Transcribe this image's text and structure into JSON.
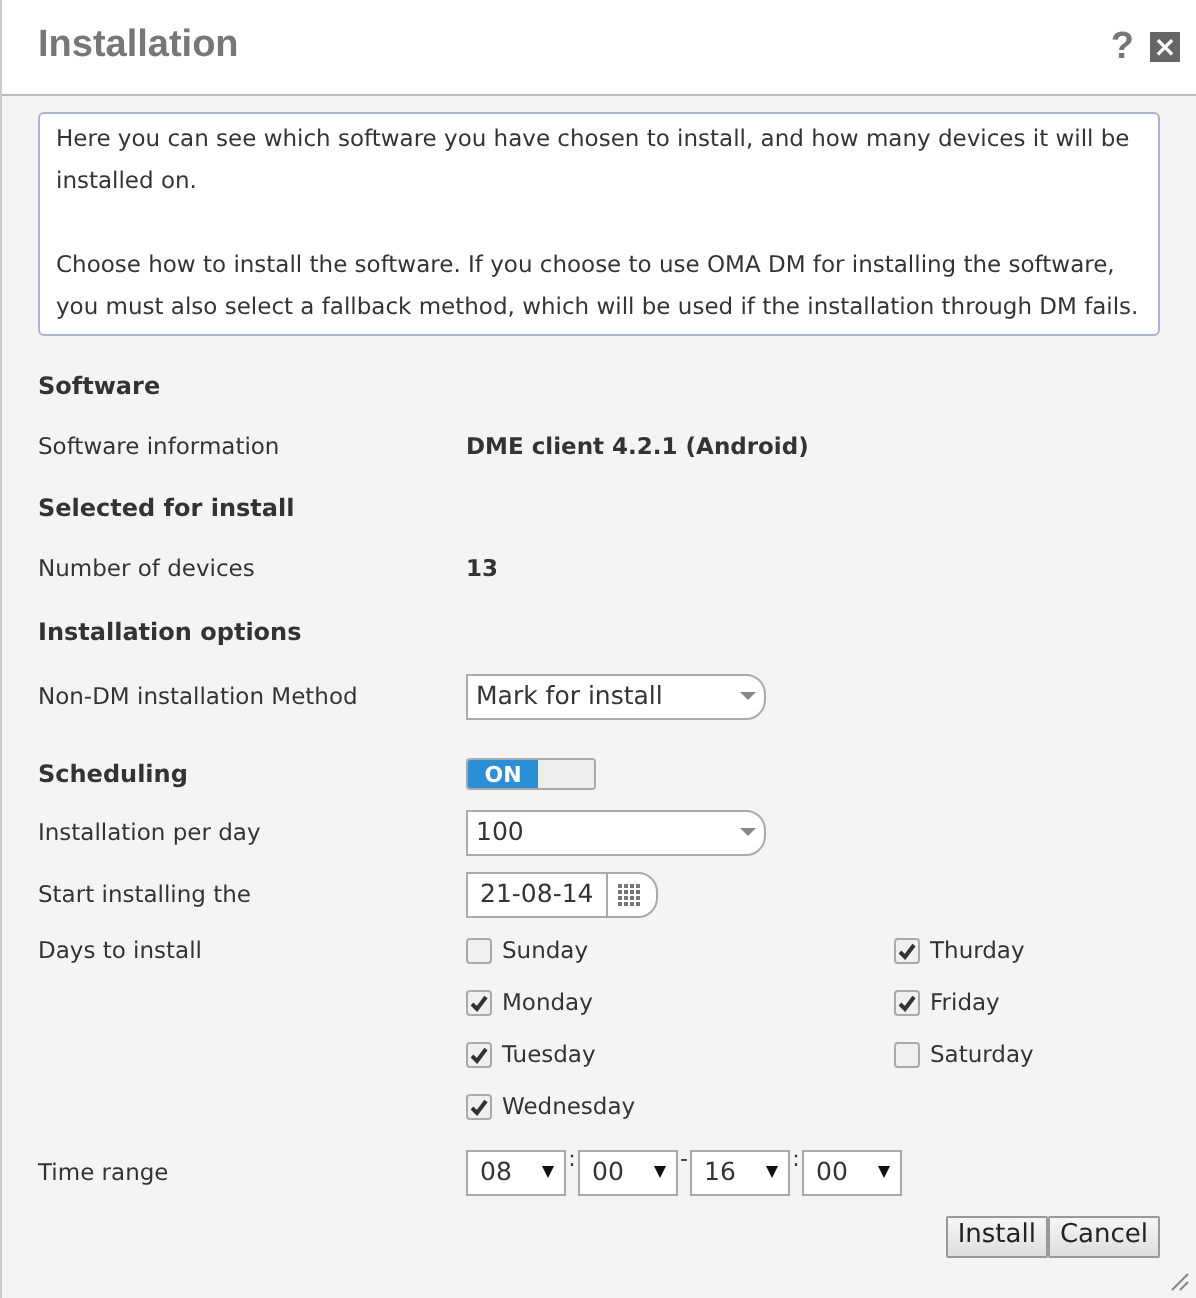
{
  "window": {
    "title": "Installation",
    "help": "?",
    "close": "×"
  },
  "intro": [
    "Here you can see which software you have chosen to install, and how many devices it will be installed on.",
    "Choose how to install the software. If you choose to use OMA DM for installing the software, you must also select a fallback method, which will be used if the installation through DM fails."
  ],
  "sections": [
    {
      "heading": "Software",
      "rows": [
        {
          "kind": "text",
          "label": "Software information",
          "value": "DME client 4.2.1 (Android)"
        }
      ]
    },
    {
      "heading": "Selected for install",
      "rows": [
        {
          "kind": "text",
          "label": "Number of devices",
          "value": "13"
        }
      ]
    },
    {
      "heading": "Installation options",
      "rows": [
        {
          "kind": "select",
          "label": "Non-DM installation Method",
          "value": "Mark for install"
        }
      ]
    },
    {
      "heading": "Scheduling",
      "toggle": {
        "label": "ON",
        "on": true
      },
      "rows": [
        {
          "kind": "select",
          "label": "Installation per day",
          "value": "100"
        },
        {
          "kind": "date",
          "label": "Start installing the",
          "value": "21-08-14"
        },
        {
          "kind": "days",
          "label": "Days to install",
          "days": [
            {
              "label": "Sunday",
              "checked": false
            },
            {
              "label": "Monday",
              "checked": true
            },
            {
              "label": "Tuesday",
              "checked": true
            },
            {
              "label": "Wednesday",
              "checked": true
            },
            {
              "label": "Thurday",
              "checked": true
            },
            {
              "label": "Friday",
              "checked": true
            },
            {
              "label": "Saturday",
              "checked": false
            }
          ]
        },
        {
          "kind": "time",
          "label": "Time range",
          "parts": [
            {
              "kind": "field",
              "value": "08"
            },
            {
              "kind": "sep",
              "value": ":"
            },
            {
              "kind": "field",
              "value": "00"
            },
            {
              "kind": "sep",
              "value": "-"
            },
            {
              "kind": "field",
              "value": "16"
            },
            {
              "kind": "sep",
              "value": ":"
            },
            {
              "kind": "field",
              "value": "00"
            }
          ]
        }
      ]
    }
  ],
  "buttons": [
    "Install",
    "Cancel"
  ]
}
